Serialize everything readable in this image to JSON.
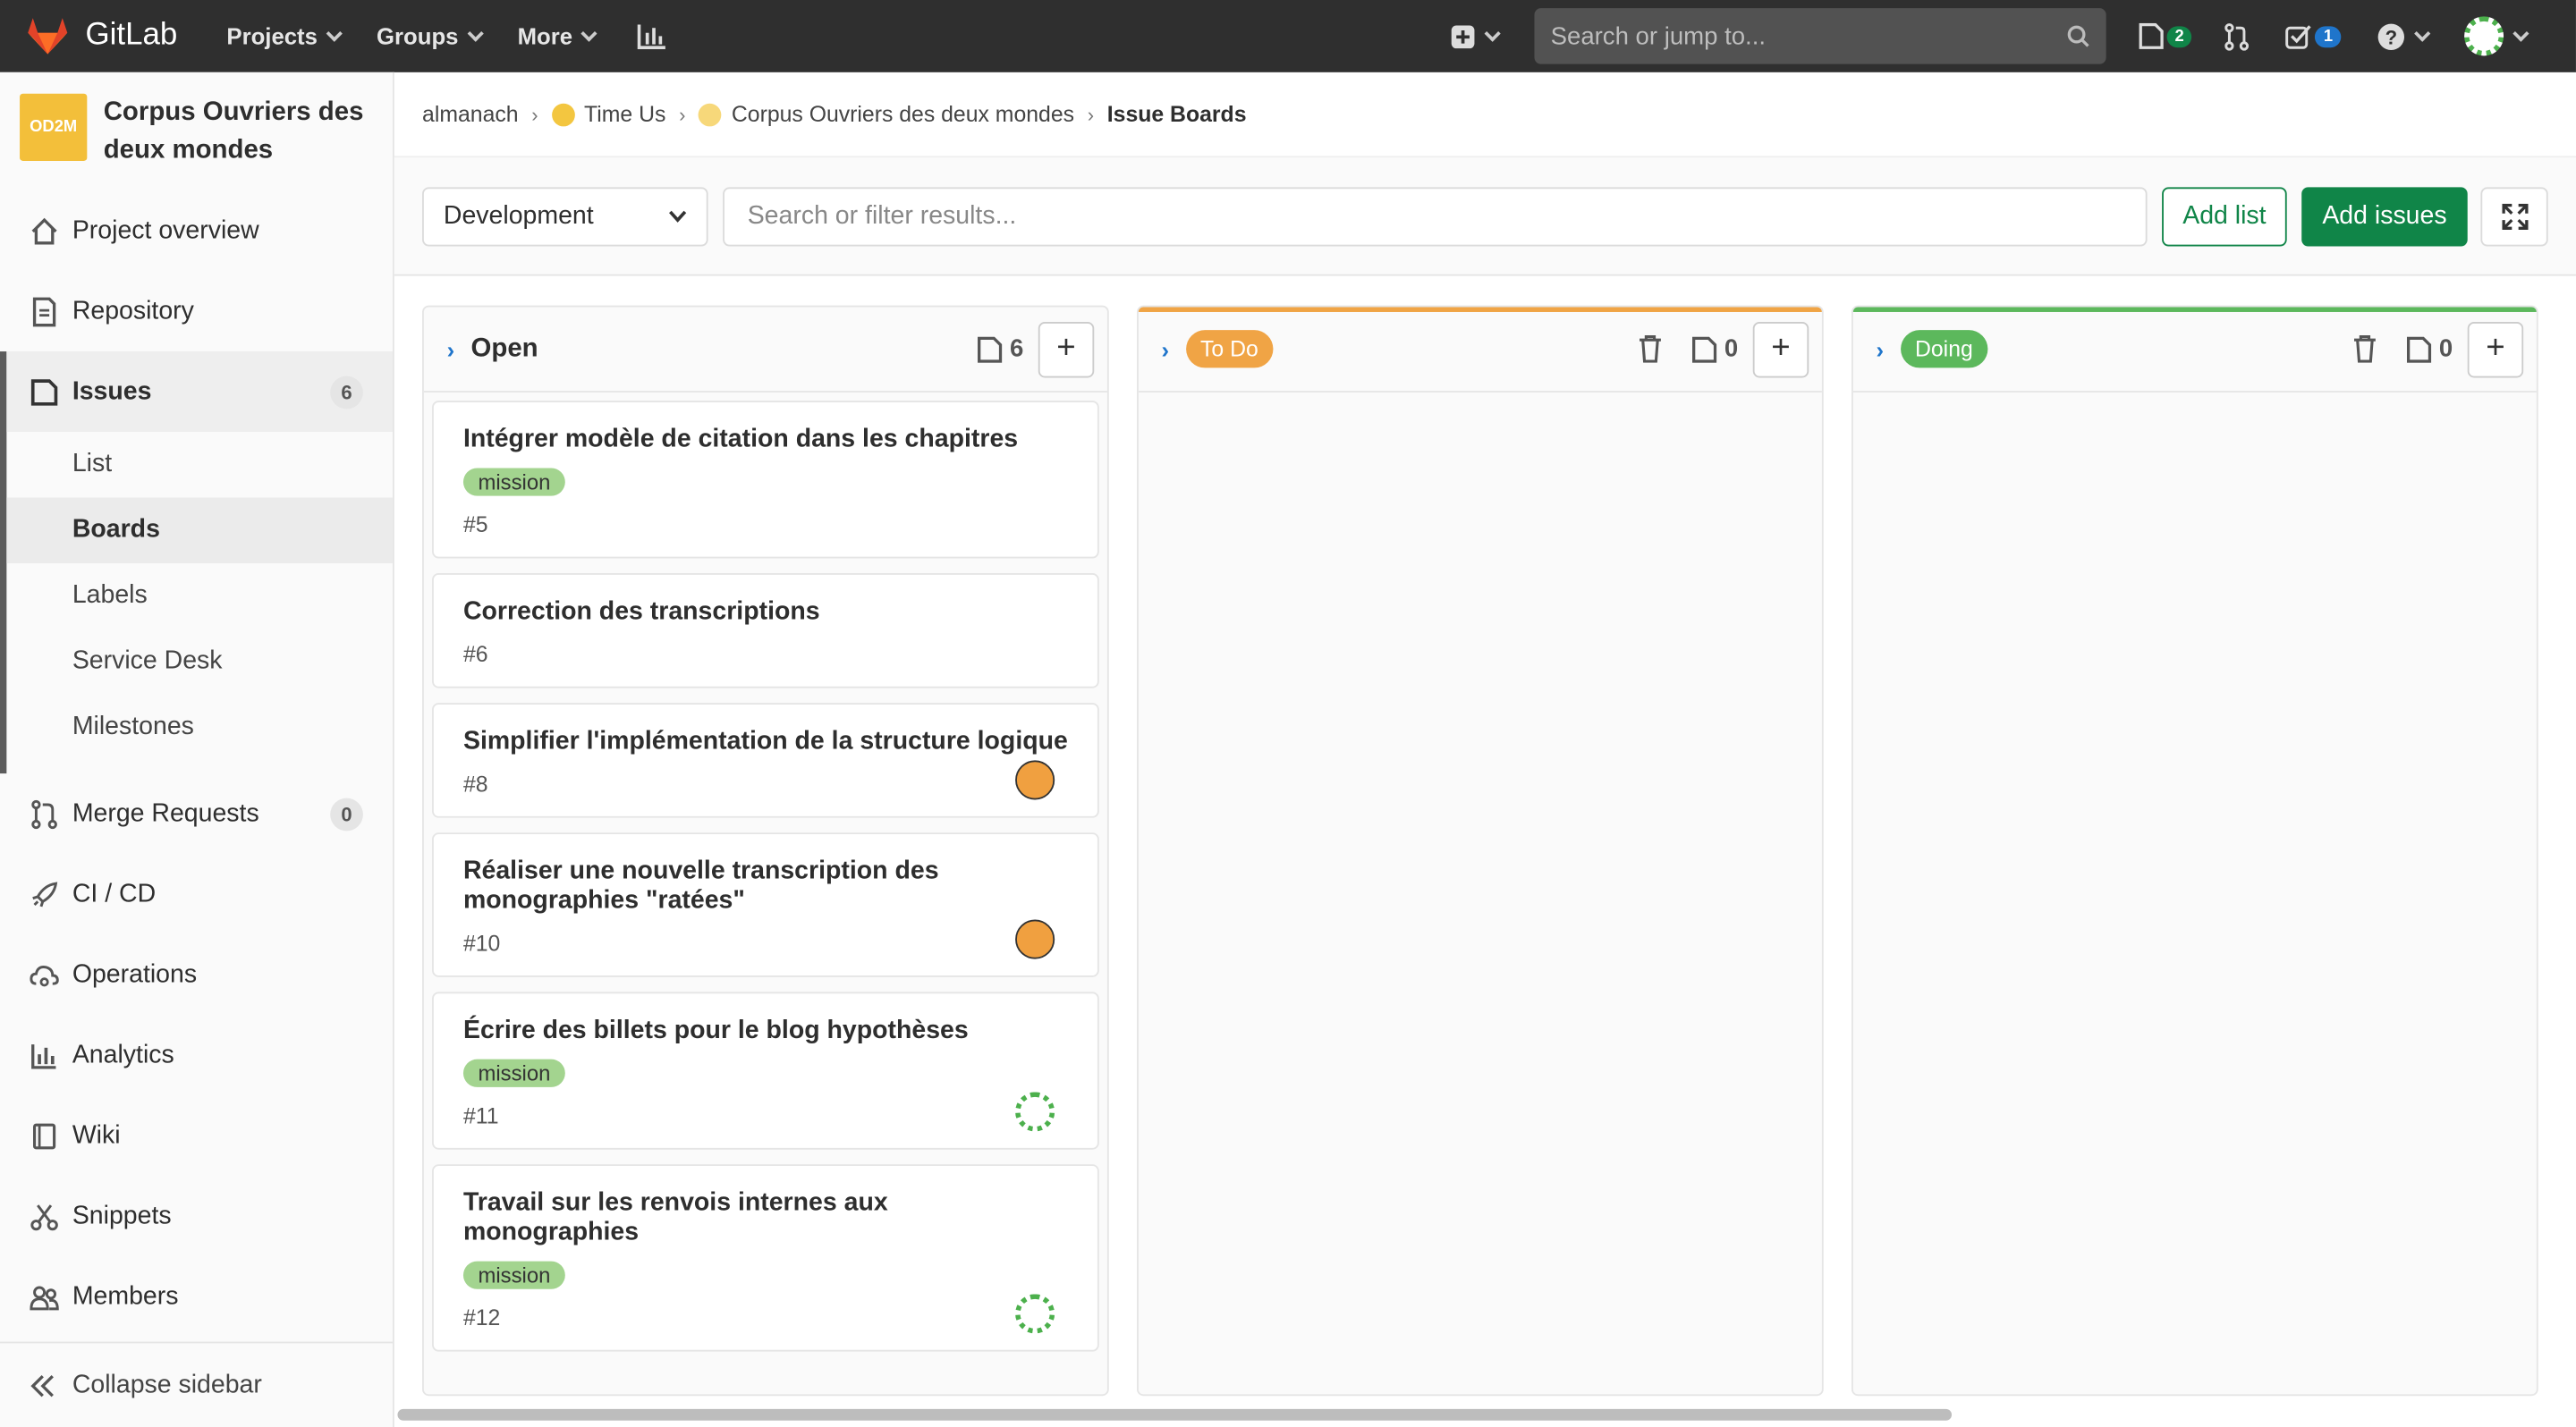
{
  "topnav": {
    "brand": "GitLab",
    "menu": [
      "Projects",
      "Groups",
      "More"
    ],
    "search_placeholder": "Search or jump to...",
    "issues_badge": "2",
    "todos_badge": "1"
  },
  "sidebar": {
    "project_logo_text": "OD2M",
    "project_name": "Corpus Ouvriers des deux mondes",
    "items": {
      "overview": "Project overview",
      "repository": "Repository",
      "issues": "Issues",
      "issues_count": "6",
      "merge_requests": "Merge Requests",
      "merge_requests_count": "0",
      "cicd": "CI / CD",
      "operations": "Operations",
      "analytics": "Analytics",
      "wiki": "Wiki",
      "snippets": "Snippets",
      "members": "Members"
    },
    "issues_sub": [
      "List",
      "Boards",
      "Labels",
      "Service Desk",
      "Milestones"
    ],
    "collapse": "Collapse sidebar"
  },
  "breadcrumb": [
    "almanach",
    "Time Us",
    "Corpus Ouvriers des deux mondes",
    "Issue Boards"
  ],
  "filters": {
    "board_select": "Development",
    "search_placeholder": "Search or filter results...",
    "add_list": "Add list",
    "add_issues": "Add issues"
  },
  "lists": [
    {
      "title": "Open",
      "count": "6",
      "cards": [
        {
          "title": "Intégrer modèle de citation dans les chapitres",
          "label": "mission",
          "num": "#5",
          "avatar": ""
        },
        {
          "title": "Correction des transcriptions",
          "label": "",
          "num": "#6",
          "avatar": ""
        },
        {
          "title": "Simplifier l'implémentation de la structure logique",
          "label": "",
          "num": "#8",
          "avatar": "emoji"
        },
        {
          "title": "Réaliser une nouvelle transcription des monographies \"ratées\"",
          "label": "",
          "num": "#10",
          "avatar": "emoji"
        },
        {
          "title": "Écrire des billets pour le blog hypothèses",
          "label": "mission",
          "num": "#11",
          "avatar": "dots"
        },
        {
          "title": "Travail sur les renvois internes aux monographies",
          "label": "mission",
          "num": "#12",
          "avatar": "dots"
        }
      ]
    },
    {
      "title": "To Do",
      "count": "0",
      "color": "#f0a445"
    },
    {
      "title": "Doing",
      "count": "0",
      "color": "#5cb85c"
    }
  ]
}
